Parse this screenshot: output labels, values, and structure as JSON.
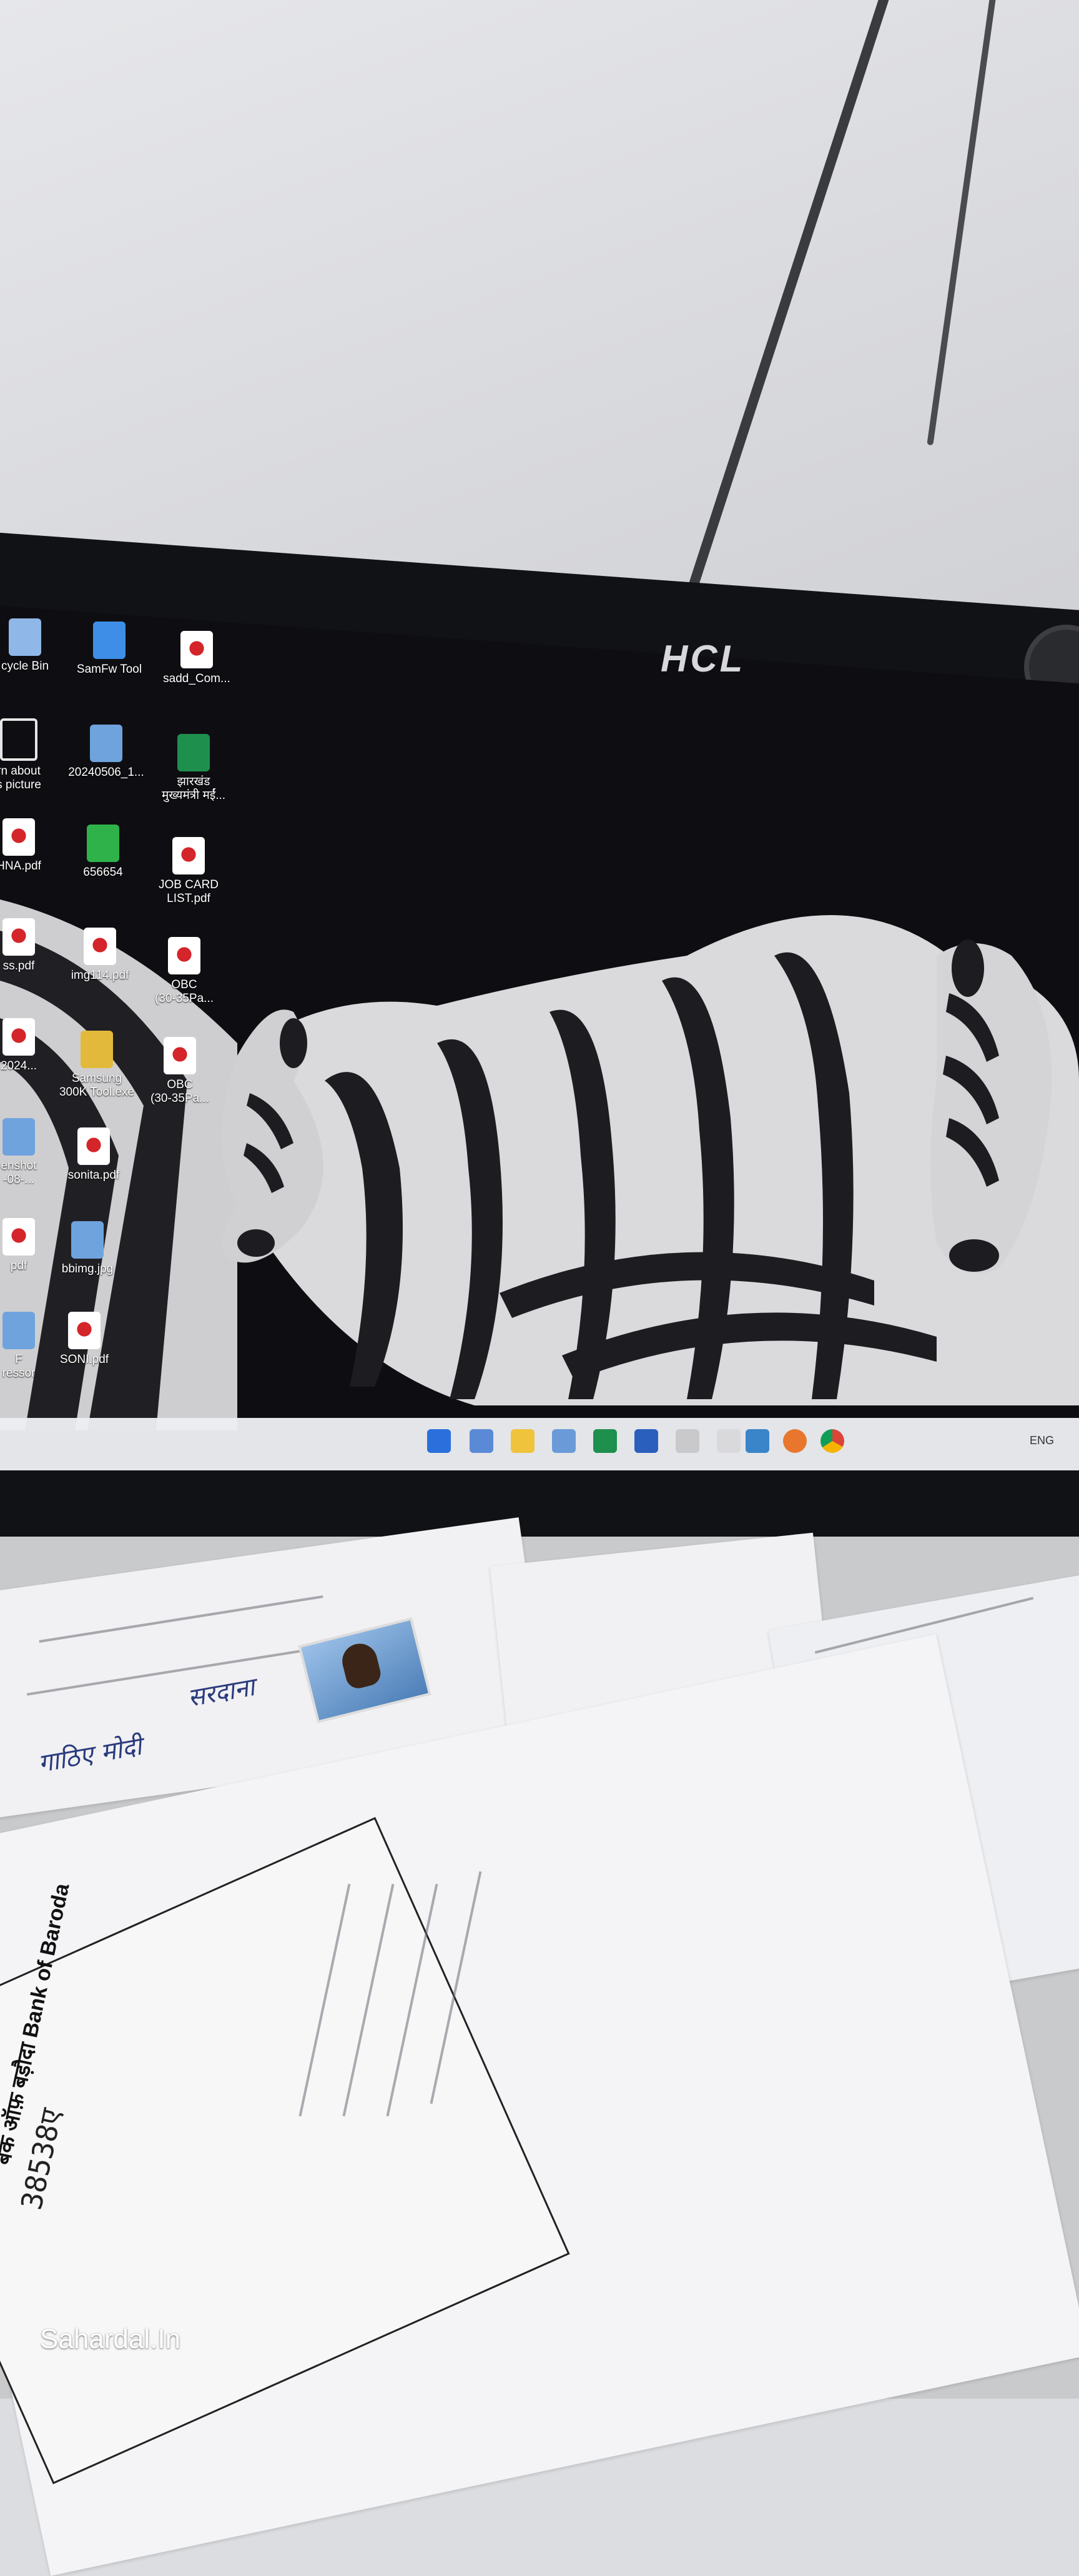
{
  "monitor": {
    "brand": "HCL"
  },
  "desktop_icons": [
    {
      "label": "cycle Bin",
      "icon": "recycle-bin-icon"
    },
    {
      "label": "SamFw Tool",
      "icon": "app-icon"
    },
    {
      "label": "sadd_Com...",
      "icon": "pdf-icon"
    },
    {
      "label": "rn about\ns picture",
      "icon": "info-circle-icon"
    },
    {
      "label": "20240506_1...",
      "icon": "image-file-icon"
    },
    {
      "label": "झारखंड\nमुख्यमंत्री मईं...",
      "icon": "excel-icon"
    },
    {
      "label": "HNA.pdf",
      "icon": "pdf-icon"
    },
    {
      "label": "656654",
      "icon": "green-app-icon"
    },
    {
      "label": "JOB CARD\nLIST.pdf",
      "icon": "pdf-icon"
    },
    {
      "label": "ss.pdf",
      "icon": "pdf-icon"
    },
    {
      "label": "img114.pdf",
      "icon": "pdf-icon"
    },
    {
      "label": "OBC\n(30-35Pa...",
      "icon": "pdf-icon"
    },
    {
      "label": "2024...",
      "icon": "pdf-icon"
    },
    {
      "label": "Samsung\n300K Tool.exe",
      "icon": "zip-icon"
    },
    {
      "label": "OBC\n(30-35Pa...",
      "icon": "pdf-icon"
    },
    {
      "label": "enshot\n-08-...",
      "icon": "image-file-icon"
    },
    {
      "label": "sonita.pdf",
      "icon": "pdf-icon"
    },
    {
      "label": "pdf",
      "icon": "pdf-icon"
    },
    {
      "label": "bbimg.jpg",
      "icon": "image-file-icon"
    },
    {
      "label": "F\nressor",
      "icon": "image-file-icon"
    },
    {
      "label": "SONI.pdf",
      "icon": "pdf-icon"
    }
  ],
  "taskbar": {
    "icons": [
      "windows-start-icon",
      "search-icon",
      "file-explorer-icon",
      "notepad-icon",
      "excel-icon",
      "word-icon",
      "document-icon",
      "pdf-reader-icon",
      "photos-icon",
      "firefox-icon",
      "chrome-icon"
    ],
    "tray_text": "ENG"
  },
  "desk": {
    "handwriting": [
      "सरदाना",
      "गाठिए मोदी"
    ],
    "bank_name": "बैंक ऑफ़ बड़ौदा  Bank of Baroda",
    "account_fragment": "38538ए"
  },
  "watermark": "Sahardal.In",
  "colors": {
    "wall": "#dcdde0",
    "bezel": "#111215",
    "taskbar": "#eceef2",
    "pdf_red": "#d3252a"
  }
}
